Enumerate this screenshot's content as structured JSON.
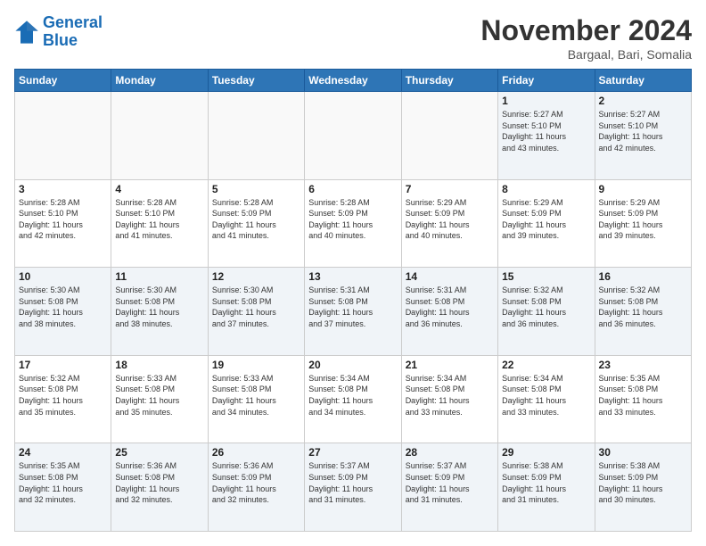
{
  "logo": {
    "line1": "General",
    "line2": "Blue"
  },
  "header": {
    "month": "November 2024",
    "location": "Bargaal, Bari, Somalia"
  },
  "weekdays": [
    "Sunday",
    "Monday",
    "Tuesday",
    "Wednesday",
    "Thursday",
    "Friday",
    "Saturday"
  ],
  "weeks": [
    [
      {
        "day": "",
        "info": ""
      },
      {
        "day": "",
        "info": ""
      },
      {
        "day": "",
        "info": ""
      },
      {
        "day": "",
        "info": ""
      },
      {
        "day": "",
        "info": ""
      },
      {
        "day": "1",
        "info": "Sunrise: 5:27 AM\nSunset: 5:10 PM\nDaylight: 11 hours\nand 43 minutes."
      },
      {
        "day": "2",
        "info": "Sunrise: 5:27 AM\nSunset: 5:10 PM\nDaylight: 11 hours\nand 42 minutes."
      }
    ],
    [
      {
        "day": "3",
        "info": "Sunrise: 5:28 AM\nSunset: 5:10 PM\nDaylight: 11 hours\nand 42 minutes."
      },
      {
        "day": "4",
        "info": "Sunrise: 5:28 AM\nSunset: 5:10 PM\nDaylight: 11 hours\nand 41 minutes."
      },
      {
        "day": "5",
        "info": "Sunrise: 5:28 AM\nSunset: 5:09 PM\nDaylight: 11 hours\nand 41 minutes."
      },
      {
        "day": "6",
        "info": "Sunrise: 5:28 AM\nSunset: 5:09 PM\nDaylight: 11 hours\nand 40 minutes."
      },
      {
        "day": "7",
        "info": "Sunrise: 5:29 AM\nSunset: 5:09 PM\nDaylight: 11 hours\nand 40 minutes."
      },
      {
        "day": "8",
        "info": "Sunrise: 5:29 AM\nSunset: 5:09 PM\nDaylight: 11 hours\nand 39 minutes."
      },
      {
        "day": "9",
        "info": "Sunrise: 5:29 AM\nSunset: 5:09 PM\nDaylight: 11 hours\nand 39 minutes."
      }
    ],
    [
      {
        "day": "10",
        "info": "Sunrise: 5:30 AM\nSunset: 5:08 PM\nDaylight: 11 hours\nand 38 minutes."
      },
      {
        "day": "11",
        "info": "Sunrise: 5:30 AM\nSunset: 5:08 PM\nDaylight: 11 hours\nand 38 minutes."
      },
      {
        "day": "12",
        "info": "Sunrise: 5:30 AM\nSunset: 5:08 PM\nDaylight: 11 hours\nand 37 minutes."
      },
      {
        "day": "13",
        "info": "Sunrise: 5:31 AM\nSunset: 5:08 PM\nDaylight: 11 hours\nand 37 minutes."
      },
      {
        "day": "14",
        "info": "Sunrise: 5:31 AM\nSunset: 5:08 PM\nDaylight: 11 hours\nand 36 minutes."
      },
      {
        "day": "15",
        "info": "Sunrise: 5:32 AM\nSunset: 5:08 PM\nDaylight: 11 hours\nand 36 minutes."
      },
      {
        "day": "16",
        "info": "Sunrise: 5:32 AM\nSunset: 5:08 PM\nDaylight: 11 hours\nand 36 minutes."
      }
    ],
    [
      {
        "day": "17",
        "info": "Sunrise: 5:32 AM\nSunset: 5:08 PM\nDaylight: 11 hours\nand 35 minutes."
      },
      {
        "day": "18",
        "info": "Sunrise: 5:33 AM\nSunset: 5:08 PM\nDaylight: 11 hours\nand 35 minutes."
      },
      {
        "day": "19",
        "info": "Sunrise: 5:33 AM\nSunset: 5:08 PM\nDaylight: 11 hours\nand 34 minutes."
      },
      {
        "day": "20",
        "info": "Sunrise: 5:34 AM\nSunset: 5:08 PM\nDaylight: 11 hours\nand 34 minutes."
      },
      {
        "day": "21",
        "info": "Sunrise: 5:34 AM\nSunset: 5:08 PM\nDaylight: 11 hours\nand 33 minutes."
      },
      {
        "day": "22",
        "info": "Sunrise: 5:34 AM\nSunset: 5:08 PM\nDaylight: 11 hours\nand 33 minutes."
      },
      {
        "day": "23",
        "info": "Sunrise: 5:35 AM\nSunset: 5:08 PM\nDaylight: 11 hours\nand 33 minutes."
      }
    ],
    [
      {
        "day": "24",
        "info": "Sunrise: 5:35 AM\nSunset: 5:08 PM\nDaylight: 11 hours\nand 32 minutes."
      },
      {
        "day": "25",
        "info": "Sunrise: 5:36 AM\nSunset: 5:08 PM\nDaylight: 11 hours\nand 32 minutes."
      },
      {
        "day": "26",
        "info": "Sunrise: 5:36 AM\nSunset: 5:09 PM\nDaylight: 11 hours\nand 32 minutes."
      },
      {
        "day": "27",
        "info": "Sunrise: 5:37 AM\nSunset: 5:09 PM\nDaylight: 11 hours\nand 31 minutes."
      },
      {
        "day": "28",
        "info": "Sunrise: 5:37 AM\nSunset: 5:09 PM\nDaylight: 11 hours\nand 31 minutes."
      },
      {
        "day": "29",
        "info": "Sunrise: 5:38 AM\nSunset: 5:09 PM\nDaylight: 11 hours\nand 31 minutes."
      },
      {
        "day": "30",
        "info": "Sunrise: 5:38 AM\nSunset: 5:09 PM\nDaylight: 11 hours\nand 30 minutes."
      }
    ]
  ]
}
